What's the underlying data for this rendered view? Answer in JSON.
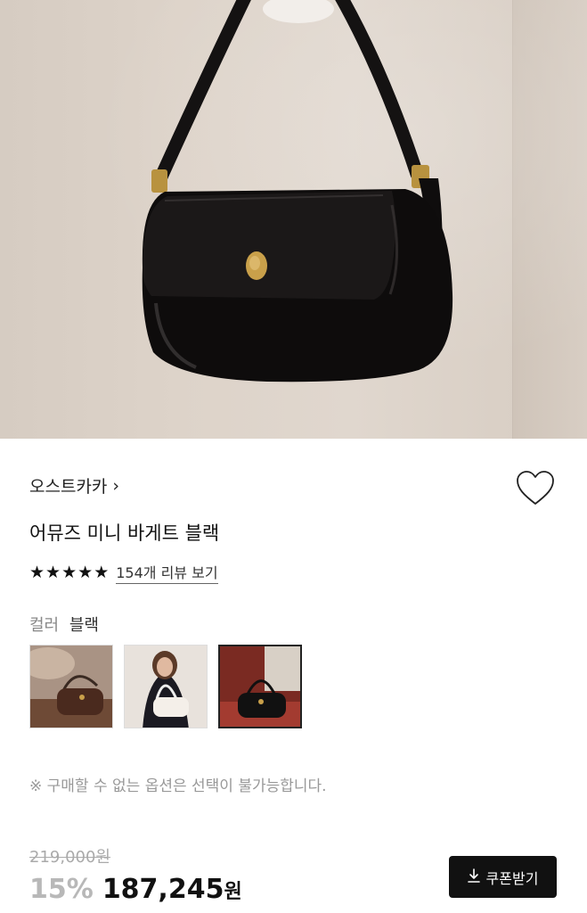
{
  "product": {
    "brand": "오스트카카",
    "brand_chevron": "›",
    "title": "어뮤즈 미니 바게트 블랙",
    "rating": {
      "stars": 5,
      "review_link": "154개 리뷰 보기"
    }
  },
  "options": {
    "color_label": "컬러",
    "color_value": "블랙",
    "swatches": [
      {
        "name": "브라운",
        "selected": false
      },
      {
        "name": "화이트",
        "selected": false
      },
      {
        "name": "블랙",
        "selected": true
      }
    ],
    "notice": "※ 구매할 수 없는 옵션은 선택이 불가능합니다."
  },
  "price": {
    "original": "219,000원",
    "discount": "15%",
    "final": "187,245",
    "currency": "원"
  },
  "coupon_button": {
    "label": "쿠폰받기"
  },
  "colors": {
    "text_primary": "#111111",
    "text_muted": "#999999",
    "discount": "#b8b8b8",
    "button_bg": "#111111"
  }
}
